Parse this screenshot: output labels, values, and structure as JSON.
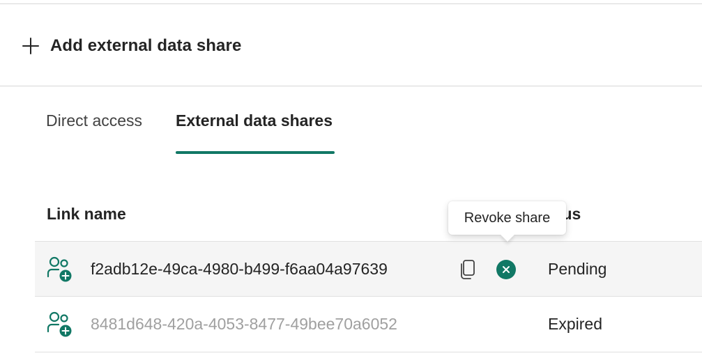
{
  "toolbar": {
    "add_label": "Add external data share",
    "add_icon": "plus-icon"
  },
  "tabs": [
    {
      "label": "Direct access",
      "selected": false
    },
    {
      "label": "External data shares",
      "selected": true
    }
  ],
  "table": {
    "columns": {
      "link_name": "Link name",
      "status": "atus"
    },
    "rows": [
      {
        "link_name": "f2adb12e-49ca-4980-b499-f6aa04a97639",
        "status": "Pending",
        "icon": "people-add-icon"
      },
      {
        "link_name": "8481d648-420a-4053-8477-49bee70a6052",
        "status": "Expired",
        "icon": "people-add-icon"
      }
    ]
  },
  "tooltip": {
    "text": "Revoke share"
  },
  "colors": {
    "accent": "#117865",
    "text_primary": "#242424",
    "text_disabled": "#a0a0a0",
    "row_hover": "#f5f5f5"
  }
}
